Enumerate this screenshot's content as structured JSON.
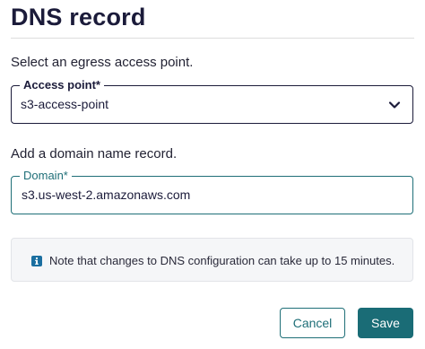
{
  "title": "DNS record",
  "egress": {
    "prompt": "Select an egress access point.",
    "label": "Access point*",
    "value": "s3-access-point",
    "icon": "chevron-down-icon"
  },
  "domain": {
    "prompt": "Add a domain name record.",
    "label": "Domain*",
    "value": "s3.us-west-2.amazonaws.com"
  },
  "note": {
    "icon": "info-icon",
    "text": "Note that changes to DNS configuration can take up to 15 minutes."
  },
  "actions": {
    "cancel_label": "Cancel",
    "save_label": "Save"
  },
  "colors": {
    "text": "#1b1b3a",
    "accent": "#1a6c76",
    "info": "#1b6fa0"
  }
}
